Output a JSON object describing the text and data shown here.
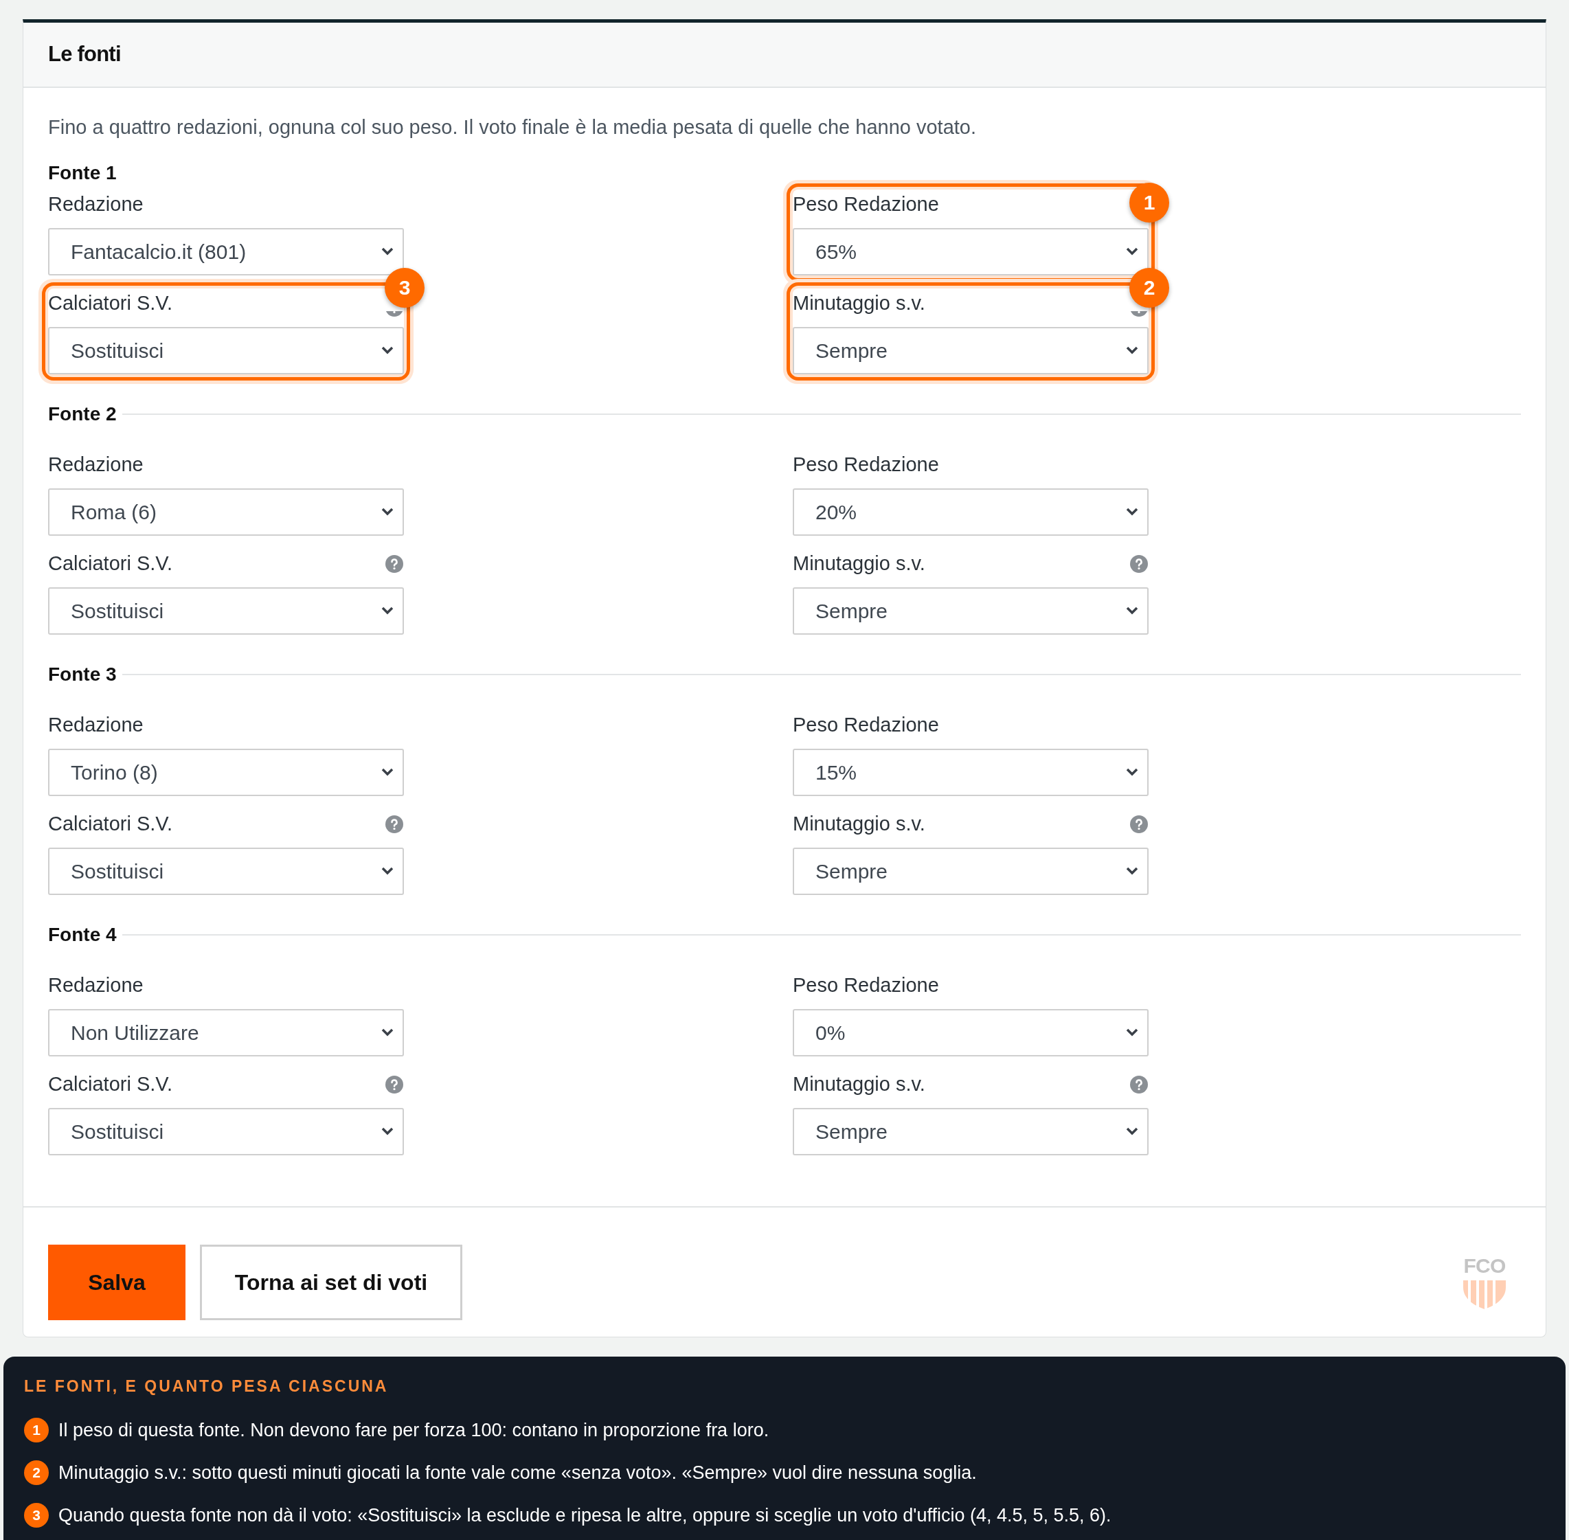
{
  "card": {
    "title": "Le fonti",
    "intro": "Fino a quattro redazioni, ognuna col suo peso. Il voto finale è la media pesata di quelle che hanno votato.",
    "sources": [
      {
        "heading": "Fonte 1",
        "divider": false,
        "fields": [
          {
            "label": "Redazione",
            "value": "Fantacalcio.it (801)",
            "help": false
          },
          {
            "label": "Peso Redazione",
            "value": "65%",
            "help": false,
            "callout": "1"
          },
          {
            "label": "Calciatori S.V.",
            "value": "Sostituisci",
            "help": true,
            "callout": "3"
          },
          {
            "label": "Minutaggio s.v.",
            "value": "Sempre",
            "help": true,
            "callout": "2"
          }
        ]
      },
      {
        "heading": "Fonte 2",
        "divider": true,
        "fields": [
          {
            "label": "Redazione",
            "value": "Roma (6)",
            "help": false
          },
          {
            "label": "Peso Redazione",
            "value": "20%",
            "help": false
          },
          {
            "label": "Calciatori S.V.",
            "value": "Sostituisci",
            "help": true
          },
          {
            "label": "Minutaggio s.v.",
            "value": "Sempre",
            "help": true
          }
        ]
      },
      {
        "heading": "Fonte 3",
        "divider": true,
        "fields": [
          {
            "label": "Redazione",
            "value": "Torino (8)",
            "help": false
          },
          {
            "label": "Peso Redazione",
            "value": "15%",
            "help": false
          },
          {
            "label": "Calciatori S.V.",
            "value": "Sostituisci",
            "help": true
          },
          {
            "label": "Minutaggio s.v.",
            "value": "Sempre",
            "help": true
          }
        ]
      },
      {
        "heading": "Fonte 4",
        "divider": true,
        "fields": [
          {
            "label": "Redazione",
            "value": "Non Utilizzare",
            "help": false
          },
          {
            "label": "Peso Redazione",
            "value": "0%",
            "help": false
          },
          {
            "label": "Calciatori S.V.",
            "value": "Sostituisci",
            "help": true
          },
          {
            "label": "Minutaggio s.v.",
            "value": "Sempre",
            "help": true
          }
        ]
      }
    ],
    "buttons": [
      {
        "label": "Salva",
        "kind": "primary"
      },
      {
        "label": "Torna ai set di voti",
        "kind": "secondary"
      }
    ],
    "logo": "FCO"
  },
  "legend": {
    "title": "LE FONTI, E QUANTO PESA CIASCUNA",
    "items": [
      {
        "number": "1",
        "text": "Il peso di questa fonte. Non devono fare per forza 100: contano in proporzione fra loro."
      },
      {
        "number": "2",
        "text": "Minutaggio s.v.: sotto questi minuti giocati la fonte vale come «senza voto». «Sempre» vuol dire nessuna soglia."
      },
      {
        "number": "3",
        "text": "Quando questa fonte non dà il voto: «Sostituisci» la esclude e ripesa le altre, oppure si sceglie un voto d'ufficio (4, 4.5, 5, 5.5, 6)."
      }
    ]
  }
}
